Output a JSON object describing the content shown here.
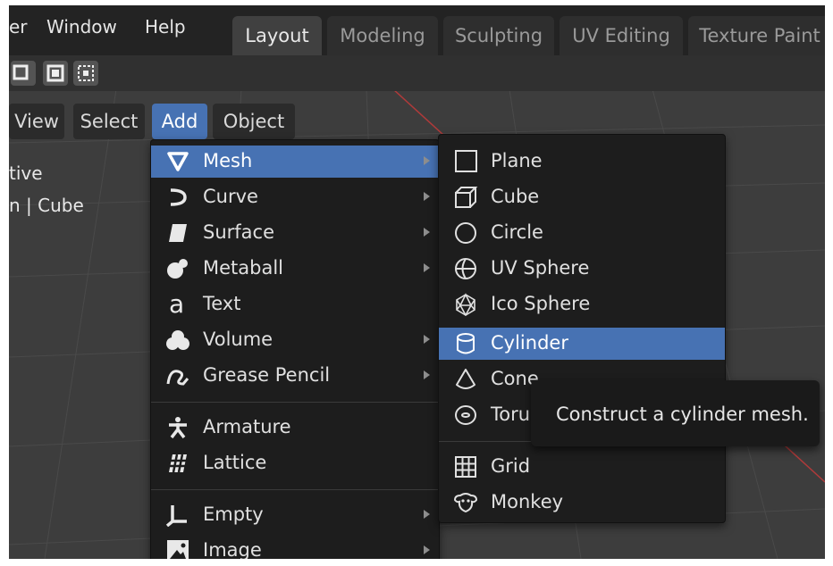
{
  "topbar": {
    "menus": [
      "er",
      "Window",
      "Help"
    ],
    "tabs": [
      "Layout",
      "Modeling",
      "Sculpting",
      "UV Editing",
      "Texture Paint"
    ],
    "active_tab": "Layout"
  },
  "header": {
    "buttons": [
      "View",
      "Select",
      "Add",
      "Object"
    ],
    "active": "Add"
  },
  "viewport_overlay": {
    "line1": "tive",
    "line2": "n | Cube"
  },
  "add_menu": {
    "items": [
      {
        "label": "Mesh",
        "icon": "mesh-icon",
        "submenu": true,
        "highlighted": true
      },
      {
        "label": "Curve",
        "icon": "curve-icon",
        "submenu": true
      },
      {
        "label": "Surface",
        "icon": "surface-icon",
        "submenu": true
      },
      {
        "label": "Metaball",
        "icon": "metaball-icon",
        "submenu": true
      },
      {
        "label": "Text",
        "icon": "text-icon",
        "submenu": false
      },
      {
        "label": "Volume",
        "icon": "volume-icon",
        "submenu": true
      },
      {
        "label": "Grease Pencil",
        "icon": "grease-pencil-icon",
        "submenu": true
      },
      {
        "label": "Armature",
        "icon": "armature-icon",
        "submenu": false
      },
      {
        "label": "Lattice",
        "icon": "lattice-icon",
        "submenu": false
      },
      {
        "label": "Empty",
        "icon": "empty-icon",
        "submenu": true
      },
      {
        "label": "Image",
        "icon": "image-icon",
        "submenu": true
      }
    ]
  },
  "mesh_menu": {
    "items": [
      {
        "label": "Plane",
        "icon": "plane-icon"
      },
      {
        "label": "Cube",
        "icon": "cube-icon"
      },
      {
        "label": "Circle",
        "icon": "circle-icon"
      },
      {
        "label": "UV Sphere",
        "icon": "uv-sphere-icon"
      },
      {
        "label": "Ico Sphere",
        "icon": "ico-sphere-icon"
      },
      {
        "label": "Cylinder",
        "icon": "cylinder-icon",
        "highlighted": true
      },
      {
        "label": "Cone",
        "icon": "cone-icon"
      },
      {
        "label": "Torus",
        "icon": "torus-icon"
      },
      {
        "label": "Grid",
        "icon": "grid-icon"
      },
      {
        "label": "Monkey",
        "icon": "monkey-icon"
      }
    ]
  },
  "tooltip": {
    "text": "Construct a cylinder mesh."
  },
  "colors": {
    "accent": "#4772b3",
    "menu_bg": "#1d1d1d",
    "viewport_bg": "#3d3d3d",
    "axis_red": "#b03a3a"
  }
}
